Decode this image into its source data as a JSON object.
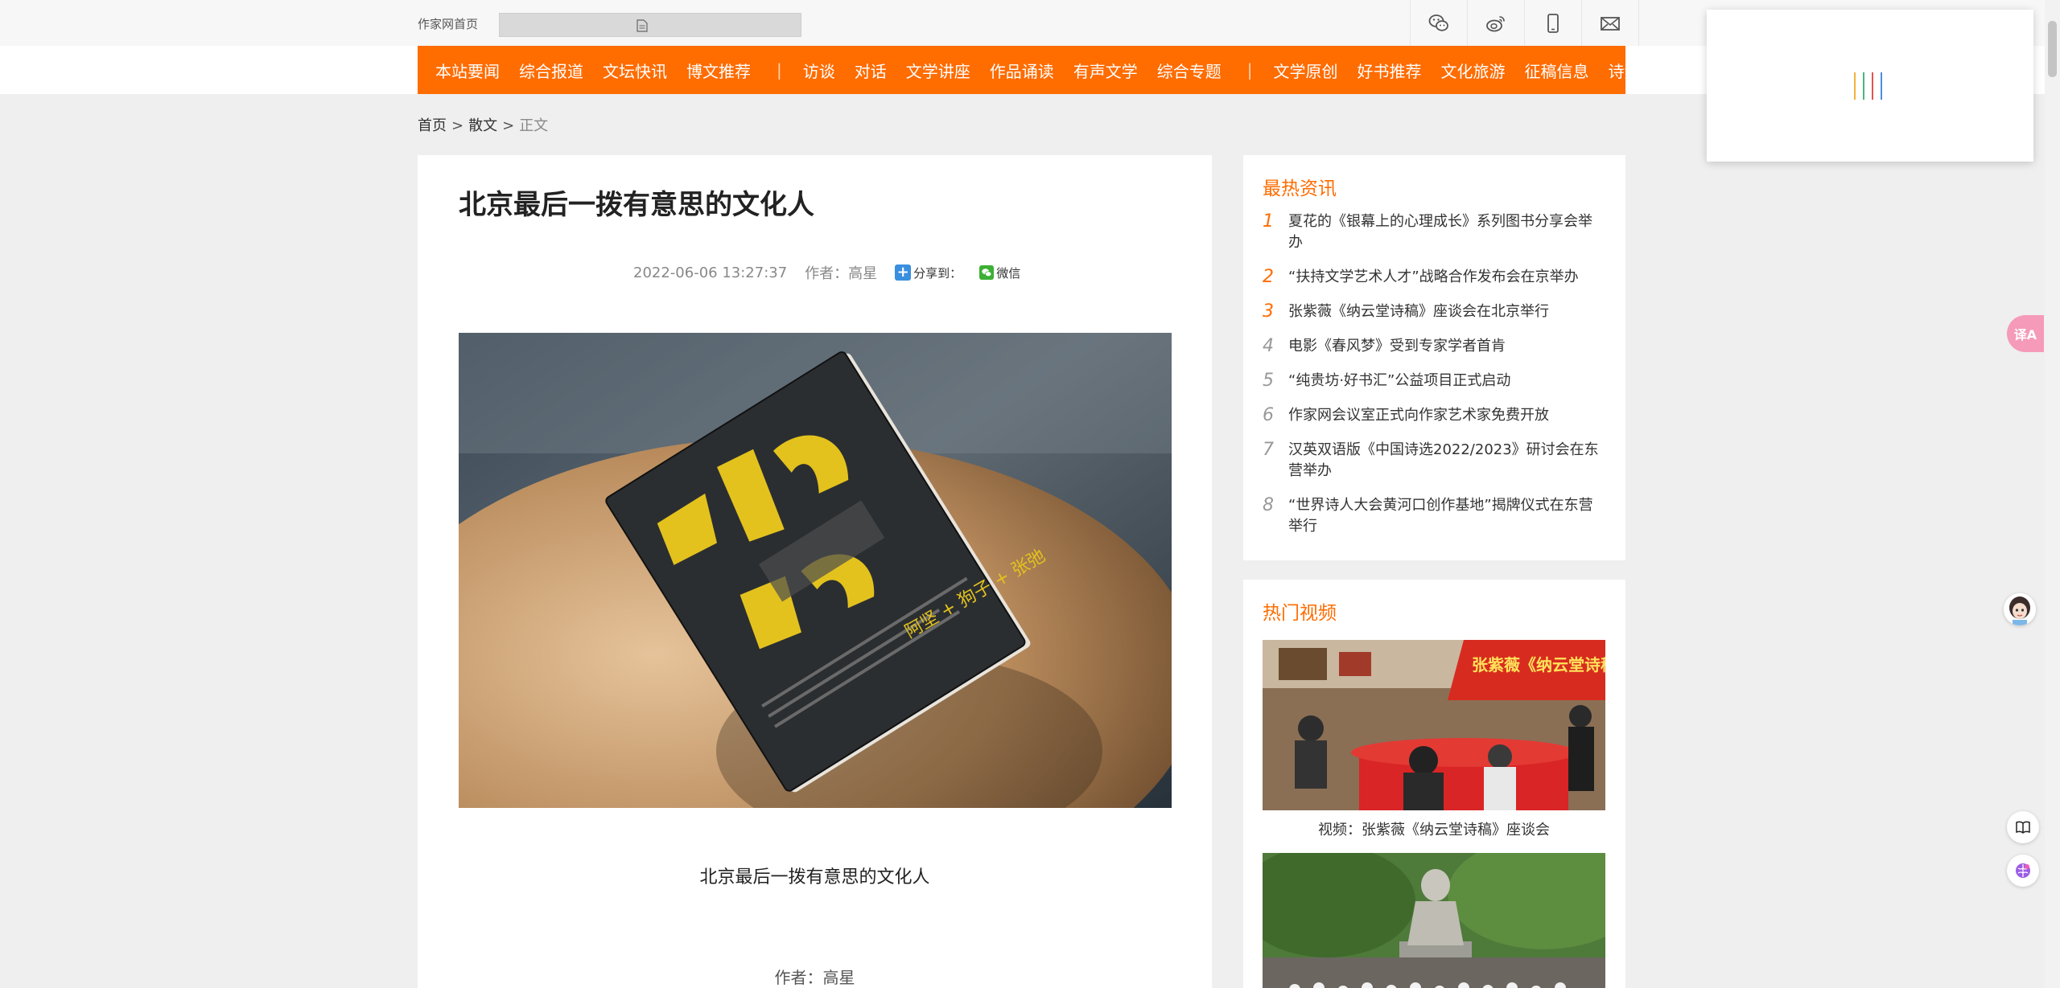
{
  "topbar": {
    "home_link": "作家网首页",
    "search_placeholder": "",
    "icons": [
      "wechat-icon",
      "weibo-icon",
      "mobile-icon",
      "mail-icon"
    ]
  },
  "nav": {
    "group1": [
      "本站要闻",
      "综合报道",
      "文坛快讯",
      "博文推荐"
    ],
    "group2": [
      "访谈",
      "对话",
      "文学讲座",
      "作品诵读",
      "有声文学",
      "综合专题"
    ],
    "group3": [
      "文学原创",
      "好书推荐",
      "文化旅游",
      "征稿信息",
      "诗酒文化"
    ],
    "separator": "|"
  },
  "breadcrumb": {
    "home": "首页",
    "sep": ">",
    "category": "散文",
    "current": "正文"
  },
  "article": {
    "title": "北京最后一拨有意思的文化人",
    "date": "2022-06-06 13:27:37",
    "author": "作者：高星",
    "share_label": "分享到：",
    "share_wechat": "微信",
    "image_caption": "北京最后一拨有意思的文化人",
    "byline": "作者：高星",
    "book_cover_title": "乱碼",
    "book_cover_authors": "阿坚 + 狗子 + 张弛"
  },
  "sidebar": {
    "hot_news_title": "最热资讯",
    "hot_news": [
      {
        "rank": "1",
        "text": "夏花的《银幕上的心理成长》系列图书分享会举办"
      },
      {
        "rank": "2",
        "text": "“扶持文学艺术人才”战略合作发布会在京举办"
      },
      {
        "rank": "3",
        "text": "张紫薇《纳云堂诗稿》座谈会在北京举行"
      },
      {
        "rank": "4",
        "text": "电影《春风梦》受到专家学者首肯"
      },
      {
        "rank": "5",
        "text": "“纯贵坊·好书汇”公益项目正式启动"
      },
      {
        "rank": "6",
        "text": "作家网会议室正式向作家艺术家免费开放"
      },
      {
        "rank": "7",
        "text": "汉英双语版《中国诗选2022/2023》研讨会在东营举办"
      },
      {
        "rank": "8",
        "text": "“世界诗人大会黄河口创作基地”揭牌仪式在东营举行"
      }
    ],
    "hot_video_title": "热门视频",
    "videos": [
      {
        "title": "视频：张紫薇《纳云堂诗稿》座谈会",
        "banner": "张紫薇《纳云堂诗稿》座谈会"
      },
      {
        "title": ""
      }
    ]
  },
  "floating": {
    "translate_label": "译A"
  },
  "colors": {
    "accent": "#ff6c00",
    "page_bg": "#efefef"
  }
}
